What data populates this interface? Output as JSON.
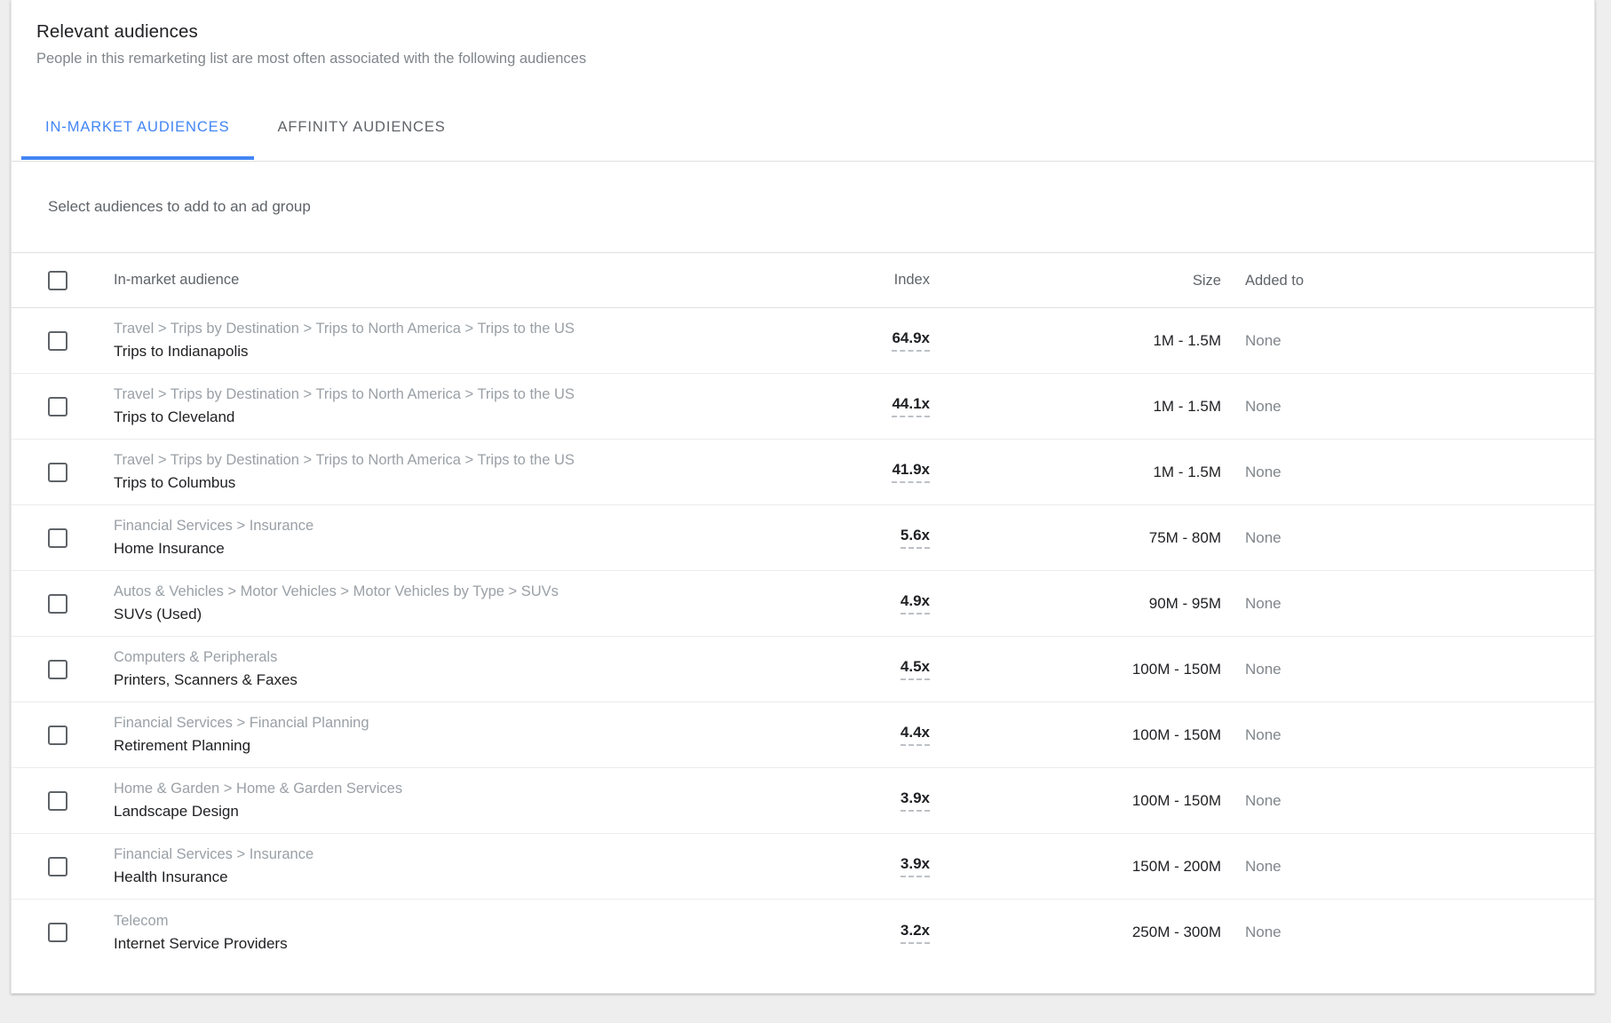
{
  "panel": {
    "title": "Relevant audiences",
    "subtitle": "People in this remarketing list are most often associated with the following audiences"
  },
  "tabs": [
    {
      "label": "IN-MARKET AUDIENCES",
      "active": true
    },
    {
      "label": "AFFINITY AUDIENCES",
      "active": false
    }
  ],
  "select_bar": {
    "text": "Select audiences to add to an ad group"
  },
  "colors": {
    "accent": "#4285f4",
    "text_primary": "#202124",
    "text_secondary": "#5f6368",
    "text_muted": "#9aa0a6",
    "divider": "#e0e0e0",
    "page_background": "#eeeeee",
    "card_background": "#ffffff"
  },
  "table": {
    "columns": {
      "name": "In-market audience",
      "index": "Index",
      "size": "Size",
      "added_to": "Added to"
    },
    "rows": [
      {
        "breadcrumb": "Travel > Trips by Destination > Trips to North America > Trips to the US",
        "name": "Trips to Indianapolis",
        "index": "64.9x",
        "size": "1M - 1.5M",
        "added_to": "None",
        "checked": false
      },
      {
        "breadcrumb": "Travel > Trips by Destination > Trips to North America > Trips to the US",
        "name": "Trips to Cleveland",
        "index": "44.1x",
        "size": "1M - 1.5M",
        "added_to": "None",
        "checked": false
      },
      {
        "breadcrumb": "Travel > Trips by Destination > Trips to North America > Trips to the US",
        "name": "Trips to Columbus",
        "index": "41.9x",
        "size": "1M - 1.5M",
        "added_to": "None",
        "checked": false
      },
      {
        "breadcrumb": "Financial Services > Insurance",
        "name": "Home Insurance",
        "index": "5.6x",
        "size": "75M - 80M",
        "added_to": "None",
        "checked": false
      },
      {
        "breadcrumb": "Autos & Vehicles > Motor Vehicles > Motor Vehicles by Type > SUVs",
        "name": "SUVs (Used)",
        "index": "4.9x",
        "size": "90M - 95M",
        "added_to": "None",
        "checked": false
      },
      {
        "breadcrumb": "Computers & Peripherals",
        "name": "Printers, Scanners & Faxes",
        "index": "4.5x",
        "size": "100M - 150M",
        "added_to": "None",
        "checked": false
      },
      {
        "breadcrumb": "Financial Services > Financial Planning",
        "name": "Retirement Planning",
        "index": "4.4x",
        "size": "100M - 150M",
        "added_to": "None",
        "checked": false
      },
      {
        "breadcrumb": "Home & Garden > Home & Garden Services",
        "name": "Landscape Design",
        "index": "3.9x",
        "size": "100M - 150M",
        "added_to": "None",
        "checked": false
      },
      {
        "breadcrumb": "Financial Services > Insurance",
        "name": "Health Insurance",
        "index": "3.9x",
        "size": "150M - 200M",
        "added_to": "None",
        "checked": false
      },
      {
        "breadcrumb": "Telecom",
        "name": "Internet Service Providers",
        "index": "3.2x",
        "size": "250M - 300M",
        "added_to": "None",
        "checked": false
      }
    ]
  }
}
